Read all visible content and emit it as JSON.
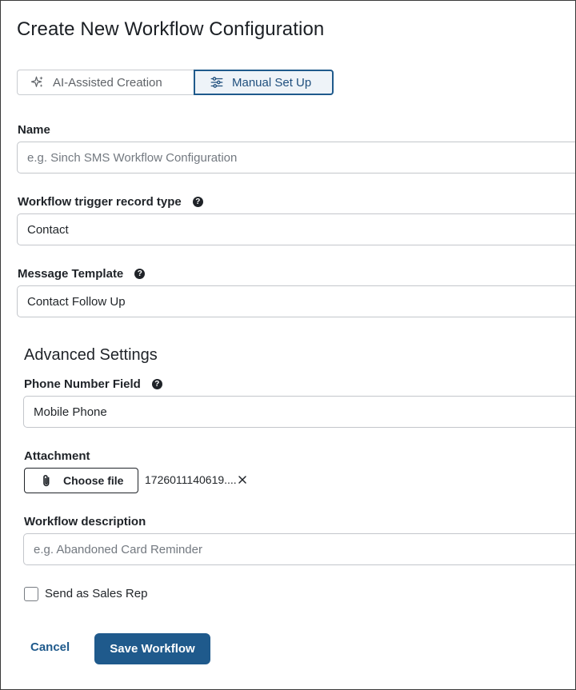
{
  "title": "Create New Workflow Configuration",
  "mode_toggle": {
    "ai_label": "AI-Assisted Creation",
    "manual_label": "Manual Set Up",
    "selected": "Manual Set Up"
  },
  "form": {
    "name": {
      "label": "Name",
      "value": "",
      "placeholder": "e.g. Sinch SMS Workflow Configuration"
    },
    "trigger_record_type": {
      "label": "Workflow trigger record type",
      "value": "Contact"
    },
    "message_template": {
      "label": "Message Template",
      "value": "Contact Follow Up"
    }
  },
  "advanced": {
    "title": "Advanced Settings",
    "phone_number_field": {
      "label": "Phone Number Field",
      "value": "Mobile Phone"
    },
    "attachment": {
      "label": "Attachment",
      "button_label": "Choose file",
      "file_name": "1726011140619...."
    },
    "workflow_description": {
      "label": "Workflow description",
      "value": "",
      "placeholder": "e.g. Abandoned Card Reminder"
    },
    "send_as_sales_rep": {
      "label": "Send as Sales Rep",
      "checked": false
    }
  },
  "actions": {
    "cancel_label": "Cancel",
    "save_label": "Save Workflow"
  },
  "icons": {
    "ai": "sparkles-icon",
    "manual": "sliders-icon",
    "help": "question-circle-icon",
    "attach": "paperclip-icon",
    "remove": "close-icon"
  },
  "colors": {
    "primary": "#1f5a8c",
    "selected_bg": "#eef3f8",
    "border": "#c3c6cb",
    "text": "#1f2328",
    "placeholder": "#737980"
  }
}
